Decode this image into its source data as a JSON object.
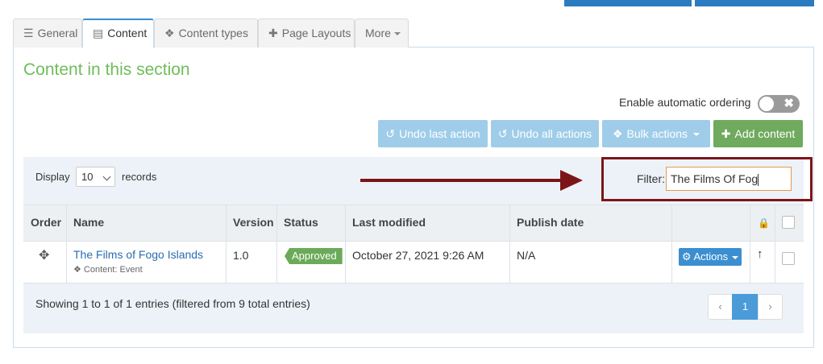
{
  "tabs": [
    {
      "label": "General",
      "icon": "sliders-icon"
    },
    {
      "label": "Content",
      "icon": "document-icon"
    },
    {
      "label": "Content types",
      "icon": "cubes-icon"
    },
    {
      "label": "Page Layouts",
      "icon": "puzzle-icon"
    },
    {
      "label": "More",
      "icon": "caret-down-icon"
    }
  ],
  "section_title": "Content in this section",
  "auto_ordering": {
    "label": "Enable automatic ordering",
    "enabled": false
  },
  "toolbar": {
    "undo_last": "Undo last action",
    "undo_all": "Undo all actions",
    "bulk_actions": "Bulk actions",
    "add_content": "Add content"
  },
  "length": {
    "display_label": "Display",
    "value": "10",
    "records_label": "records"
  },
  "filter": {
    "label": "Filter:",
    "value": "The Films Of Fog"
  },
  "table": {
    "headers": {
      "order": "Order",
      "name": "Name",
      "version": "Version",
      "status": "Status",
      "last_modified": "Last modified",
      "publish_date": "Publish date"
    },
    "rows": [
      {
        "name": "The Films of Fogo Islands",
        "content_type": "Content: Event",
        "version": "1.0",
        "status": "Approved",
        "last_modified": "October 27, 2021 9:26 AM",
        "publish_date": "N/A",
        "actions_label": "Actions"
      }
    ]
  },
  "footer": {
    "info": "Showing 1 to 1 of 1 entries (filtered from 9 total entries)",
    "current_page": "1"
  },
  "colors": {
    "accent_blue": "#3b8ed0",
    "success_green": "#6aaa59",
    "title_green": "#6ebd5a",
    "highlight_red": "#7c1518"
  }
}
